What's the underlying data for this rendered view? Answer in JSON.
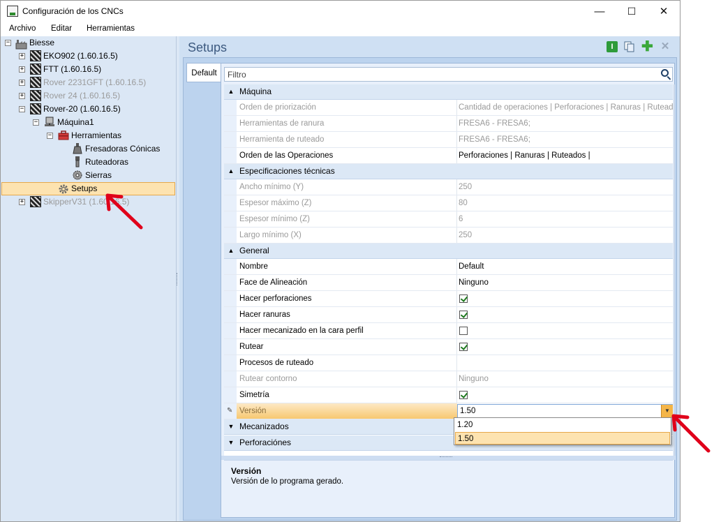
{
  "window": {
    "title": "Configuración de los CNCs",
    "minimize": "—",
    "maximize": "☐",
    "close": "✕"
  },
  "menu": [
    "Archivo",
    "Editar",
    "Herramientas"
  ],
  "tree": {
    "root": "Biesse",
    "machines": [
      {
        "label": "EKO902 (1.60.16.5)",
        "disabled": false
      },
      {
        "label": "FTT (1.60.16.5)",
        "disabled": false
      },
      {
        "label": "Rover 2231GFT (1.60.16.5)",
        "disabled": true
      },
      {
        "label": "Rover 24 (1.60.16.5)",
        "disabled": true
      },
      {
        "label": "Rover-20 (1.60.16.5)",
        "disabled": false
      }
    ],
    "machine_node": "Máquina1",
    "tools_node": "Herramientas",
    "tools": [
      "Fresadoras Cónicas",
      "Ruteadoras",
      "Sierras"
    ],
    "setups_node": "Setups",
    "last_machine": "SkipperV31 (1.60.16.5)"
  },
  "panel": {
    "title": "Setups",
    "tab": "Default",
    "filter_placeholder": "Filtro"
  },
  "grid": {
    "categories": {
      "maquina": "Máquina",
      "especificaciones": "Especificaciones técnicas",
      "general": "General",
      "mecanizados": "Mecanizados",
      "perforaciones": "Perforaciónes"
    },
    "maquina_rows": [
      {
        "name": "Orden de priorización",
        "value": "Cantidad de operaciones | Perforaciones | Ranuras | Ruteados",
        "readonly": true
      },
      {
        "name": "Herramientas de ranura",
        "value": "FRESA6 - FRESA6;",
        "readonly": true
      },
      {
        "name": "Herramienta de ruteado",
        "value": "FRESA6 - FRESA6;",
        "readonly": true
      },
      {
        "name": "Orden de las Operaciones",
        "value": "Perforaciones | Ranuras | Ruteados |",
        "readonly": false
      }
    ],
    "especificaciones_rows": [
      {
        "name": "Ancho mínimo (Y)",
        "value": "250"
      },
      {
        "name": "Espesor máximo (Z)",
        "value": "80"
      },
      {
        "name": "Espesor mínimo (Z)",
        "value": "6"
      },
      {
        "name": "Largo mínimo (X)",
        "value": "250"
      }
    ],
    "general_rows": [
      {
        "name": "Nombre",
        "value": "Default"
      },
      {
        "name": "Face de Alineación",
        "value": "Ninguno"
      },
      {
        "name": "Hacer perforaciones",
        "checked": true
      },
      {
        "name": "Hacer ranuras",
        "checked": true
      },
      {
        "name": "Hacer mecanizado en la cara perfil",
        "checked": false
      },
      {
        "name": "Rutear",
        "checked": true
      },
      {
        "name": "Procesos de ruteado",
        "value": ""
      },
      {
        "name": "Rutear contorno",
        "value": "Ninguno",
        "readonly": true
      },
      {
        "name": "Simetría",
        "checked": true
      },
      {
        "name": "Versión",
        "value": "1.50"
      }
    ],
    "version_options": [
      "1.20",
      "1.50"
    ],
    "selected_option": "1.50"
  },
  "description": {
    "title": "Versión",
    "text": "Versión de lo programa gerado."
  },
  "colors": {
    "accent_orange": "#f4b548",
    "selection": "#fde3b0",
    "panel_blue": "#cfe0f3",
    "annotation_red": "#e0001a"
  }
}
